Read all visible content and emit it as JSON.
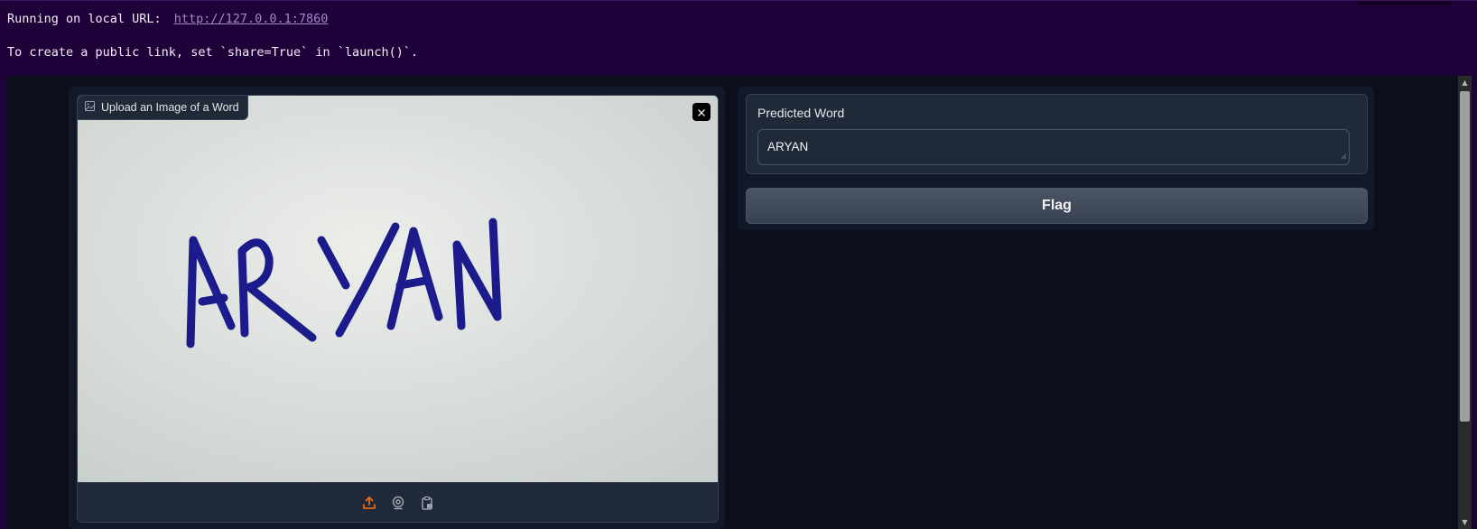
{
  "terminal": {
    "local_url_label": "Running on local URL:",
    "local_url": "http://127.0.0.1:7860",
    "share_hint": "To create a public link, set `share=True` in `launch()`."
  },
  "input": {
    "label": "Upload an Image of a Word",
    "image_icon": "image-icon",
    "image_alt": "handwritten word ARYAN on paper",
    "handwritten_text": "ARYAN",
    "clear_icon": "close-icon",
    "sources": [
      {
        "name": "upload",
        "icon": "upload-icon",
        "active": true
      },
      {
        "name": "webcam",
        "icon": "webcam-icon",
        "active": false
      },
      {
        "name": "clipboard",
        "icon": "clipboard-icon",
        "active": false
      }
    ]
  },
  "output": {
    "label": "Predicted Word",
    "value": "ARYAN"
  },
  "flag_label": "Flag",
  "colors": {
    "terminal_bg": "#1f013a",
    "app_bg": "#0b0f19",
    "panel_bg": "#111827",
    "block_bg": "#1f2937",
    "accent": "#f97316",
    "ink": "#1b1b8c"
  }
}
